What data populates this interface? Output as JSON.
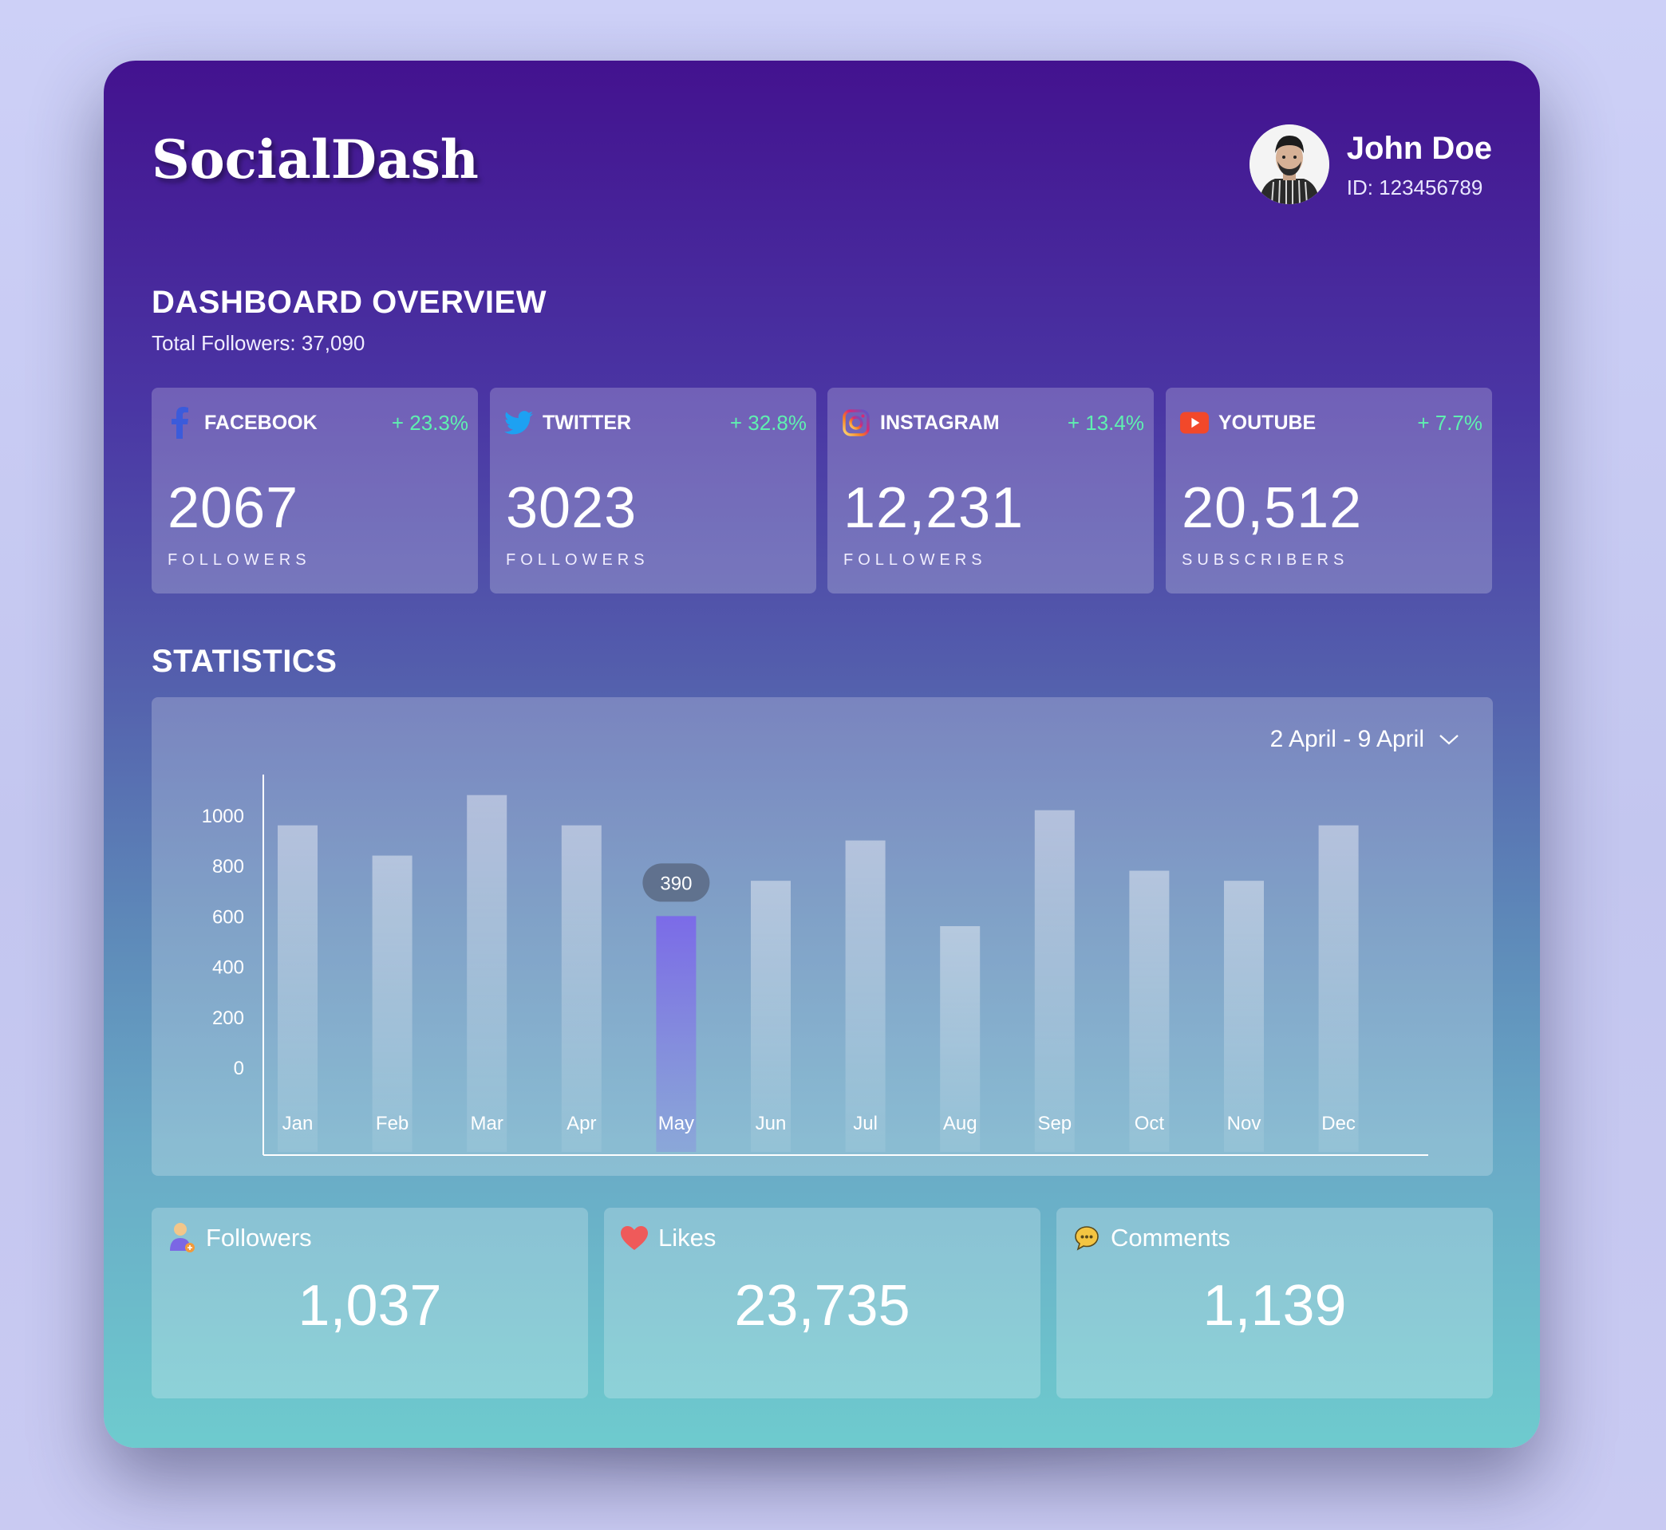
{
  "app": {
    "logo": "SocialDash"
  },
  "user": {
    "name": "John Doe",
    "id_label": "ID: 123456789"
  },
  "overview": {
    "title": "DASHBOARD OVERVIEW",
    "total_label": "Total Followers: 37,090"
  },
  "platforms": [
    {
      "name": "FACEBOOK",
      "change": "+ 23.3%",
      "count": "2067",
      "unit": "FOLLOWERS",
      "icon": "facebook-icon",
      "color": "#3b5bdb"
    },
    {
      "name": "TWITTER",
      "change": "+ 32.8%",
      "count": "3023",
      "unit": "FOLLOWERS",
      "icon": "twitter-icon",
      "color": "#1da1f2"
    },
    {
      "name": "INSTAGRAM",
      "change": "+ 13.4%",
      "count": "12,231",
      "unit": "FOLLOWERS",
      "icon": "instagram-icon",
      "color": "#e1306c"
    },
    {
      "name": "YOUTUBE",
      "change": "+ 7.7%",
      "count": "20,512",
      "unit": "SUBSCRIBERS",
      "icon": "youtube-icon",
      "color": "#ff0000"
    }
  ],
  "statistics": {
    "title": "STATISTICS",
    "date_range": "2 April - 9 April",
    "tooltip": "390"
  },
  "chart_data": {
    "type": "bar",
    "categories": [
      "Jan",
      "Feb",
      "Mar",
      "Apr",
      "May",
      "Jun",
      "Jul",
      "Aug",
      "Sep",
      "Oct",
      "Nov",
      "Dec"
    ],
    "values": [
      960,
      840,
      1080,
      960,
      600,
      740,
      900,
      560,
      1020,
      780,
      740,
      960
    ],
    "y_ticks": [
      "0",
      "200",
      "400",
      "600",
      "800",
      "1000"
    ],
    "ylim": [
      0,
      1000
    ],
    "highlighted_index": 4,
    "highlight_label": "390",
    "highlight_color": "#7c6cf0",
    "bar_color": "#c8d4ec",
    "grid": false
  },
  "summary": [
    {
      "label": "Followers",
      "value": "1,037",
      "icon": "user-icon"
    },
    {
      "label": "Likes",
      "value": "23,735",
      "icon": "heart-icon"
    },
    {
      "label": "Comments",
      "value": "1,139",
      "icon": "comment-icon"
    }
  ]
}
